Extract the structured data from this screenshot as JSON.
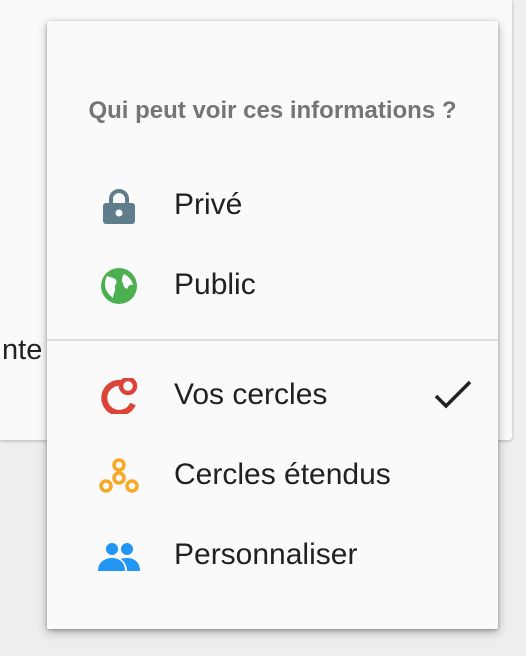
{
  "background": {
    "partial_text": "Inte"
  },
  "menu": {
    "title": "Qui peut voir ces informations ?",
    "items": [
      {
        "label": "Privé",
        "icon": "lock-icon",
        "color": "#607d8b",
        "selected": false
      },
      {
        "label": "Public",
        "icon": "globe-icon",
        "color": "#4caf50",
        "selected": false
      },
      {
        "label": "Vos cercles",
        "icon": "circles-icon",
        "color": "#db4437",
        "selected": true
      },
      {
        "label": "Cercles étendus",
        "icon": "extended-circles-icon",
        "color": "#f9a825",
        "selected": false
      },
      {
        "label": "Personnaliser",
        "icon": "people-icon",
        "color": "#2196f3",
        "selected": false
      }
    ]
  }
}
